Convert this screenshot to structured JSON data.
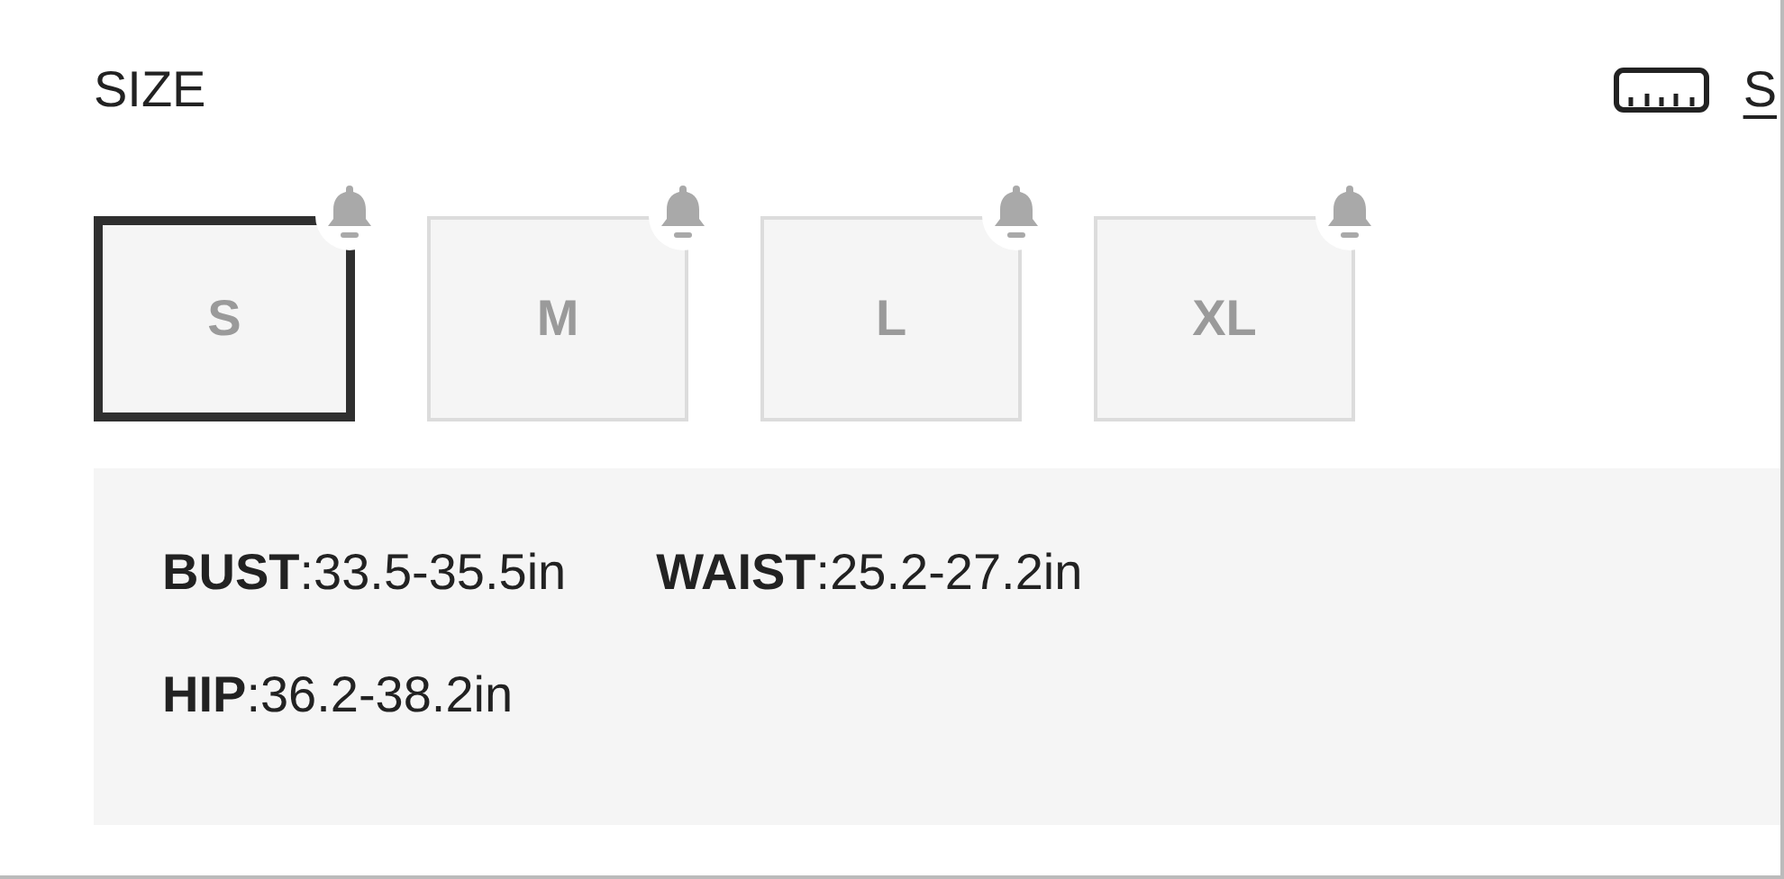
{
  "title": "SIZE",
  "guide_link": {
    "label": "S"
  },
  "sizes": [
    {
      "label": "S",
      "selected": true
    },
    {
      "label": "M",
      "selected": false
    },
    {
      "label": "L",
      "selected": false
    },
    {
      "label": "XL",
      "selected": false
    }
  ],
  "measurements": [
    [
      "**BUST**:33.5-35.5in",
      "**WAIST**:25.2-27.2in"
    ],
    [
      "**HIP**:36.2-38.2in"
    ]
  ]
}
